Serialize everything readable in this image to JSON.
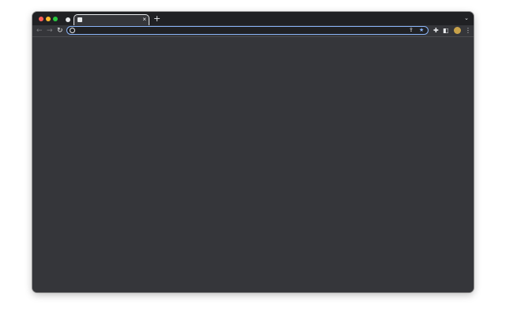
{
  "colors": {
    "titlebar_bg": "#202124",
    "toolbar_bg": "#35363a",
    "content_bg": "#35363a",
    "omnibox_border": "#8ab4f8",
    "traffic_close": "#ff5f57",
    "traffic_minimize": "#febc2e",
    "traffic_maximize": "#28c840",
    "bookmark_star": "#8ab4f8"
  },
  "tabs": [
    {
      "title": "",
      "favicon": "page-icon",
      "close_glyph": "×"
    }
  ],
  "titlebar": {
    "new_tab_glyph": "+",
    "tab_search_glyph": "chevron-down-icon",
    "tab_search_symbol": "⌄"
  },
  "toolbar": {
    "back_glyph": "←",
    "forward_glyph": "→",
    "reload_glyph": "↻",
    "omnibox": {
      "value": "",
      "placeholder": ""
    },
    "share_glyph": "⇪",
    "bookmark_glyph": "★",
    "extensions_glyph": "✚",
    "side_panel_glyph": "◧",
    "menu_glyph": "⋮"
  }
}
